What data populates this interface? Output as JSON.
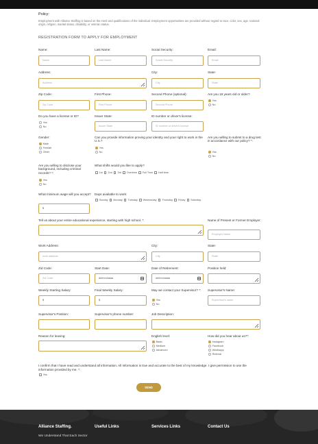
{
  "policy": {
    "title": "Policy:",
    "text": "Employment with Alliance Staffing is based on the merit and qualifications of the individual. Employment opportunities are provided without regard to race, color, sex, age, national origin, religion, marital status, disability, or veteran status."
  },
  "form": {
    "heading": "REGISTRATION FORM TO APPLY FOR EMPLOYMENT",
    "name": {
      "label": "Name:",
      "placeholder": "Name"
    },
    "last_name": {
      "label": "Last Name:",
      "placeholder": "Last Name"
    },
    "social_security": {
      "label": "Social Security:",
      "placeholder": "Social Security"
    },
    "email": {
      "label": "Email:",
      "placeholder": "Email"
    },
    "address": {
      "label": "Address:",
      "placeholder": "Address"
    },
    "city": {
      "label": "City:",
      "placeholder": "City"
    },
    "state": {
      "label": "State:",
      "placeholder": "State"
    },
    "zip": {
      "label": "Zip Code:",
      "placeholder": "Zip Code"
    },
    "first_phone": {
      "label": "First Phone:",
      "placeholder": "First Phone"
    },
    "second_phone": {
      "label": "Second Phone (optional):",
      "placeholder": "Second Phone"
    },
    "age18": {
      "label": "Are you 18 years old or older?",
      "options": [
        "Yes",
        "No"
      ],
      "selected": "Yes"
    },
    "license": {
      "label": "Do you have a license or ID?",
      "options": [
        "Yes",
        "No"
      ],
      "selected": "None"
    },
    "issuer_state": {
      "label": "Issuer State:",
      "placeholder": "Issuer State"
    },
    "id_number": {
      "label": "ID number or driver's license:",
      "placeholder": "ID number or driver's license"
    },
    "gender": {
      "label": "Gender:",
      "options": [
        "Male",
        "Female",
        "Other"
      ],
      "selected": "Male"
    },
    "work_proof": {
      "label": "Can you provide information proving your identity and your right to work in the U.S.?",
      "options": [
        "Yes",
        "No"
      ],
      "selected": "Yes"
    },
    "drug_test": {
      "label": "Are you willing to submit to a drug test in accordance with our policy? *:",
      "options": [
        "Yes",
        "No"
      ],
      "selected": "Yes"
    },
    "criminal": {
      "label": "Are you willing to disclose your background, including criminal records? *:",
      "options": [
        "Yes",
        "No"
      ],
      "selected": "Yes"
    },
    "shifts": {
      "label": "What shifts would you like to apply?",
      "options": [
        "1st",
        "2nd",
        "3rd",
        "Overtime",
        "Full Time",
        "Half time"
      ]
    },
    "min_wage": {
      "label": "What minimum wage will you accept?",
      "value": "$"
    },
    "days": {
      "label": "Days available to work:",
      "options": [
        "Sunday",
        "Monday",
        "Tuesday",
        "Wednesday",
        "Thursday",
        "Friday",
        "Saturday"
      ]
    },
    "education": {
      "label": "Tell us about your entire educational experience, starting with high school. *:"
    },
    "employer": {
      "label": "Name of Present or Former Employer:",
      "placeholder": "Employer Name"
    },
    "work_address": {
      "label": "Work Address:",
      "placeholder": "work address"
    },
    "work_city": {
      "label": "City:",
      "placeholder": "City"
    },
    "work_state": {
      "label": "State:",
      "placeholder": "State"
    },
    "work_zip": {
      "label": "Zid Code:",
      "placeholder": "Zid Code"
    },
    "start_date": {
      "label": "Start Date:",
      "placeholder": "dd/mm/aaaa"
    },
    "retirement": {
      "label": "Date of Retirement:",
      "placeholder": "dd/mm/aaaa"
    },
    "position": {
      "label": "Position held:"
    },
    "start_salary": {
      "label": "Weekly Starting Salary:",
      "value": "$"
    },
    "final_salary": {
      "label": "Final Weekly Salary:",
      "value": "$"
    },
    "contact_supervisor": {
      "label": "May we contact your Supervisor? *:",
      "options": [
        "Yes",
        "No"
      ],
      "selected": "Yes"
    },
    "supervisor_name": {
      "label": "Supervisor's Name:",
      "placeholder": "Supervisor's name"
    },
    "supervisor_position": {
      "label": "Supervisor's Position:"
    },
    "supervisor_phone": {
      "label": "Supervisor's phone number:"
    },
    "job_description": {
      "label": "Job Description:"
    },
    "reason": {
      "label": "Reason for leaving:"
    },
    "english": {
      "label": "English level:",
      "options": [
        "Basic",
        "Medium",
        "Advanced"
      ],
      "selected": "Basic"
    },
    "heard": {
      "label": "How did you hear about us?*:",
      "options": [
        "Instagram",
        "Facebook",
        "Whatsapp",
        "Referral"
      ],
      "selected": "Instagram"
    },
    "confirm": {
      "text": "I confirm that I have read and understand all information. All information is true and accurate to the best of my knowledge. I give permission to use the information provided by me. *:",
      "option": "Yes"
    },
    "submit_label": "SEND"
  },
  "footer": {
    "col1_title": "Alliance Staffing.",
    "col1_sub": "We Understand That Each Sector",
    "col2_title": "Useful Links",
    "col3_title": "Services Links",
    "col4_title": "Contact Us"
  },
  "colors": {
    "accent": "#c9a24a",
    "footer_bg": "#262626",
    "topbar": "#111111"
  }
}
